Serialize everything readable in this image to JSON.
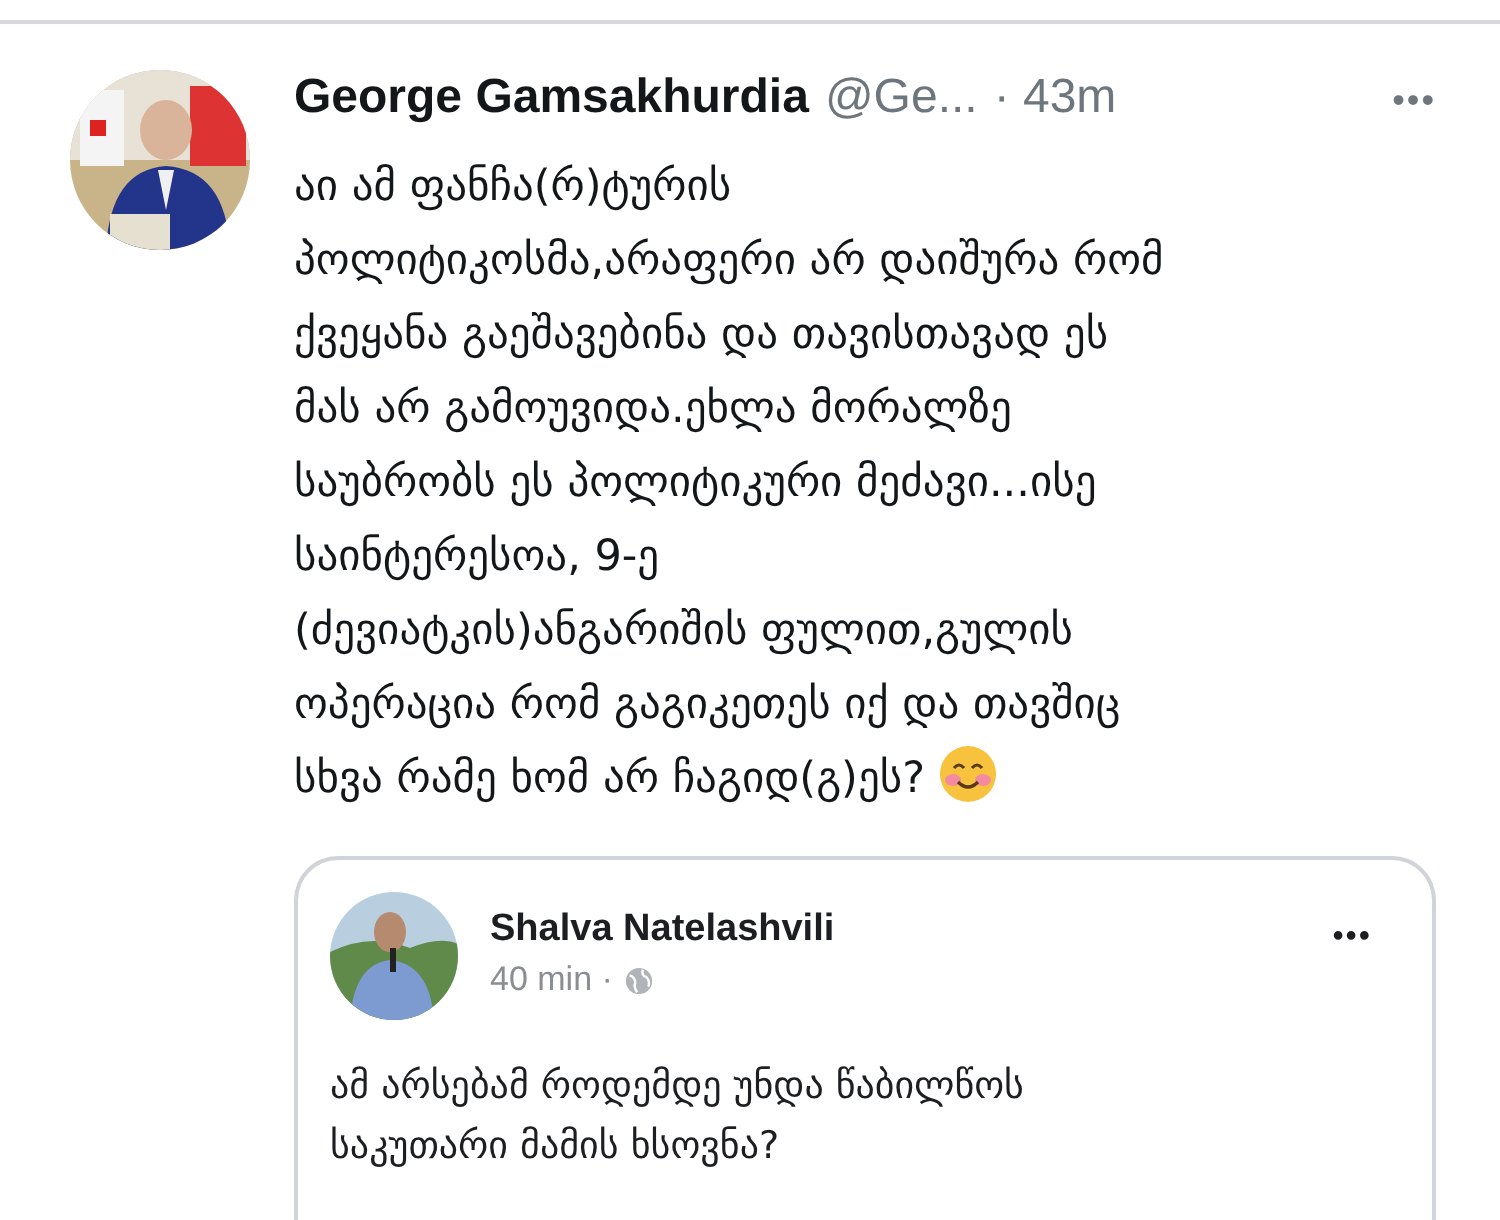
{
  "tweet": {
    "author": "George Gamsakhurdia",
    "handle": "@Ge...",
    "time": "· 43m",
    "menu": "•••",
    "body": "აი ამ ფანჩა(რ)ტურის\nპოლიტიკოსმა,არაფერი არ დაიშურა რომ\nქვეყანა გაეშავებინა და თავისთავად ეს\nმას არ გამოუვიდა.ეხლა მორალზე\nსაუბრობს ეს პოლიტიკური მეძავი...ისე\nსაინტერესოა, 9-ე\n(ძევიატკის)ანგარიშის ფულით,გულის\nოპერაცია რომ გაგიკეთეს იქ და თავშიც\nსხვა რამე ხომ არ ჩაგიდ(გ)ეს?",
    "quote": {
      "author": "Shalva Natelashvili",
      "time": "40 min ·",
      "menu": "•••",
      "body": "ამ არსებამ როდემდე უნდა წაბილწოს\nსაკუთარი მამის ხსოვნა?"
    }
  }
}
